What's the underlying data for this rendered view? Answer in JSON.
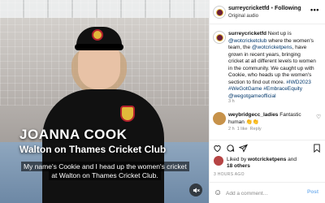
{
  "video": {
    "name_title": "JOANNA COOK",
    "club_title": "Walton on Thames Cricket Club",
    "subtitle": "My name's Cookie and I head up the women's cricket at Walton on Thames Cricket Club.",
    "audio_icon": "speaker-muted-icon"
  },
  "header": {
    "username": "surreycricketfd",
    "separator": "•",
    "follow_label": "Following",
    "audio_label": "Original audio",
    "more_icon": "more-options-icon"
  },
  "caption": {
    "username": "surreycricketfd",
    "text_1": " Next up is ",
    "mention_1": "@wotcricketclub",
    "text_2": " where the women's team, the ",
    "mention_2": "@wotcricketpens",
    "text_3": ", have grown in recent years, bringing cricket at all different levels to women in the community. We caught up with Cookie, who heads up the women's section to find out more.",
    "hashtag_1": "#IWD2023",
    "hashtag_2": "#WeGotGame",
    "hashtag_3": "#EmbraceEquity",
    "mention_3": "@wegotgameofficial",
    "time": "3 h"
  },
  "comment": {
    "username": "weybridgecc_ladies",
    "text": " Fantastic human 👏👏",
    "time": "2 h",
    "likes": "1 like",
    "reply": "Reply"
  },
  "actions": {
    "like_icon": "heart-icon",
    "comment_icon": "comment-icon",
    "share_icon": "share-icon",
    "save_icon": "bookmark-icon"
  },
  "likes": {
    "prefix": "Liked by ",
    "user": "wotcricketpens",
    "middle": " and",
    "others": "18 others"
  },
  "post_time": "3 HOURS AGO",
  "add_comment": {
    "placeholder": "Add a comment…",
    "post_label": "Post",
    "emoji_icon": "emoji-icon"
  }
}
